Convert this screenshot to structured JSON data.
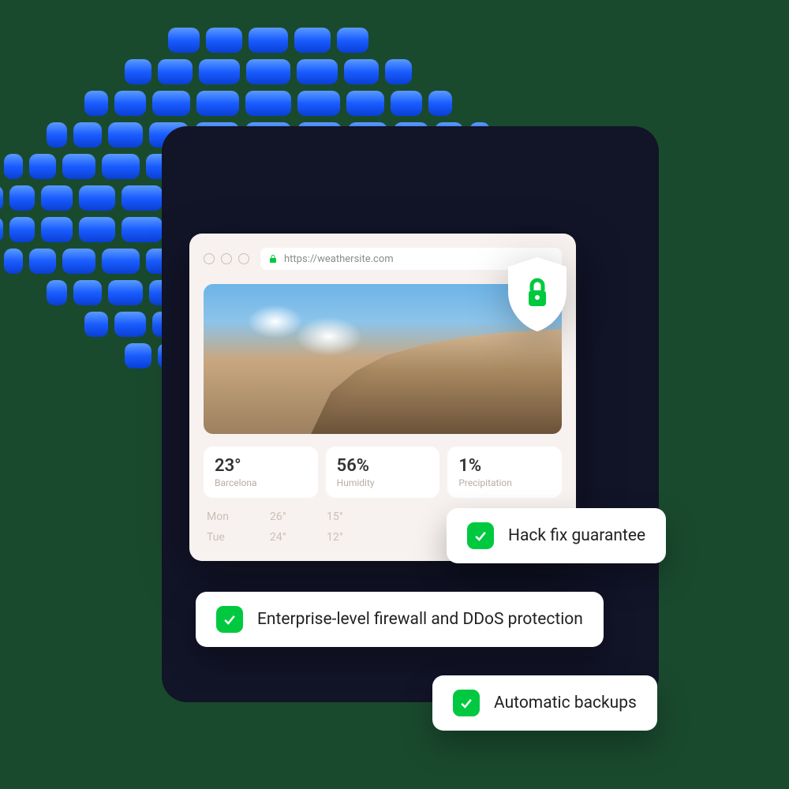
{
  "browser": {
    "url": "https://weathersite.com"
  },
  "weather": {
    "temp": {
      "value": "23°",
      "label": "Barcelona"
    },
    "humidity": {
      "value": "56%",
      "label": "Humidity"
    },
    "precipitation": {
      "value": "1%",
      "label": "Precipitation"
    },
    "forecast": [
      {
        "day": "Mon",
        "high": "26°",
        "low": "15°"
      },
      {
        "day": "Tue",
        "high": "24°",
        "low": "12°"
      }
    ]
  },
  "features": [
    "Hack fix guarantee",
    "Enterprise-level firewall and DDoS protection",
    "Automatic backups"
  ],
  "colors": {
    "accent_blue": "#1a5cff",
    "accent_green": "#00c940",
    "dark_panel": "#121428",
    "page_bg": "#1a4a2e"
  }
}
